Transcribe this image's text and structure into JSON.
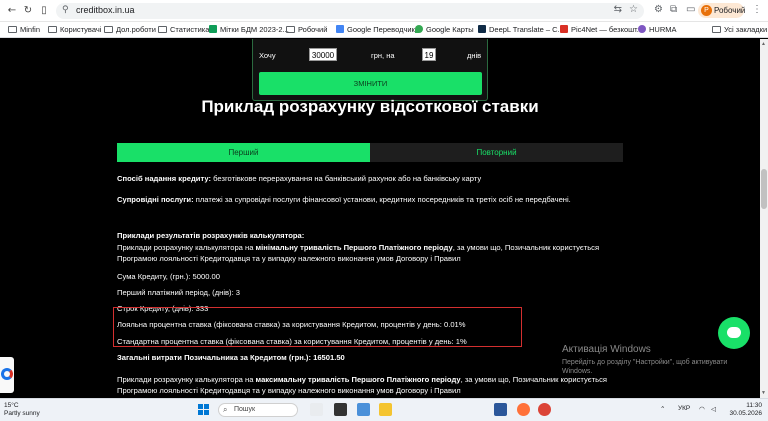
{
  "browser": {
    "url": "creditbox.in.ua",
    "profile_label": "Робочий",
    "profile_initial": "Р",
    "bookmarks": [
      "Minfin",
      "Користувачі",
      "Дол.роботи",
      "Статистика",
      "Мітки БДМ 2023-2...",
      "Робочий",
      "Google Переводчик",
      "Google Карты",
      "DeepL Translate – С...",
      "Pic4Net — безкошт...",
      "HURMA"
    ],
    "all_bookmarks_label": "Усі закладки"
  },
  "calculator": {
    "want_label": "Хочу",
    "amount_value": "30000",
    "currency_for_label": "грн, на",
    "days_value": "19",
    "days_label": "днів",
    "change_button": "ЗМІНИТИ"
  },
  "main": {
    "title": "Приклад розрахунку відсоткової ставки",
    "tabs": [
      {
        "label": "Перший",
        "active": true
      },
      {
        "label": "Повторний",
        "active": false
      }
    ],
    "paragraphs": {
      "method_bold": "Спосіб надання кредиту:",
      "method_text": " безготівкове перерахування на банківський рахунок або на банківську карту",
      "services_bold": "Супровідні послуги:",
      "services_text": " платежі за супровідні послуги фінансової установи, кредитних посередників та третіх осіб не передбачені.",
      "examples_bold": "Приклади результатів розрахунків калькулятора:",
      "examples_pre": "Приклади розрахунку калькулятора на ",
      "examples_bold2": "мінімальну тривалість Першого Платіжного періоду",
      "examples_post": ", за умови що, Позичальник користується Програмою лояльності Кредитодавця та у випадку належного виконання умов Договору і Правил",
      "sum": "Сума Кредиту, (грн.): 5000.00",
      "first_period": "Перший платіжний період, (днів): 3",
      "term": "Строк Кредиту, (днів): 333",
      "loyal_rate": "Лояльна процентна ставка (фіксована ставка) за користування Кредитом, процентів у день: 0.01%",
      "standard_rate": "Стандартна процентна ставка (фіксована ставка) за користування Кредитом, процентів у день: 1%",
      "total_costs": "Загальні витрати Позичальника за Кредитом (грн.): 16501.50",
      "examples2_pre": "Приклади розрахунку калькулятора на ",
      "examples2_bold": "максимальну тривалість Першого Платіжного періоду",
      "examples2_post": ", за умови що, Позичальник користується Програмою лояльності Кредитодавця та у випадку належного виконання умов Договору і Правил"
    }
  },
  "windows_watermark": {
    "title": "Активація Windows",
    "subtitle": "Перейдіть до розділу \"Настройки\", щоб активувати Windows."
  },
  "taskbar": {
    "temp": "15°C",
    "weather": "Partly sunny",
    "search_placeholder": "Пошук",
    "lang": "УКР",
    "time": "11:30",
    "date": "30.05.2026"
  },
  "colors": {
    "accent_green": "#19e068",
    "highlight_border": "#d32f2f",
    "page_bg": "#000000"
  }
}
